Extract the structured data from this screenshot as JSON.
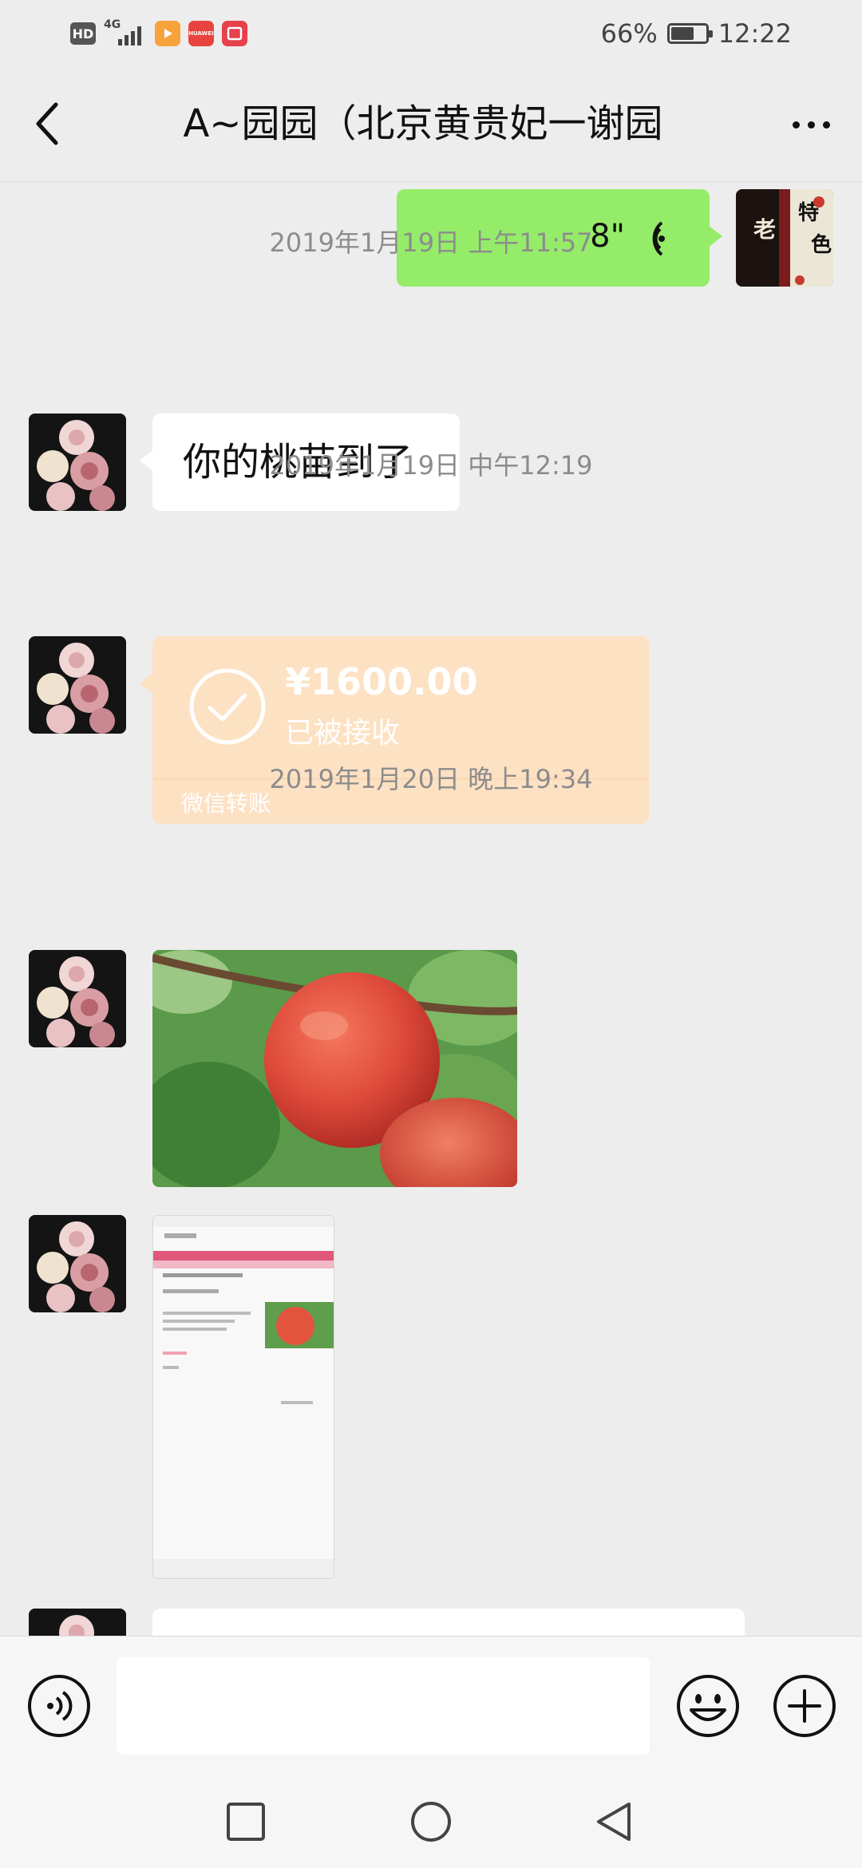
{
  "status_bar": {
    "hd": "HD",
    "network": "4G",
    "huawei_app": "HUAWEI",
    "battery": "66%",
    "battery_level": 0.66,
    "time": "12:22"
  },
  "header": {
    "back_icon": "chevron-left-icon",
    "title": "A~园园（北京黄贵妃一谢园",
    "more_icon": "more-horizontal-icon"
  },
  "messages": {
    "voice_out": {
      "duration": "8\"",
      "icon": "voice-wave-icon"
    },
    "time_1": "2019年1月19日 上午11:57",
    "text_1": "你的桃苗到了",
    "time_2": "2019年1月19日 中午12:19",
    "transfer": {
      "amount": "¥1600.00",
      "status": "已被接收",
      "type_label": "微信转账",
      "icon": "check-circle-icon"
    },
    "time_3": "2019年1月20日 晚上19:34",
    "avatar_me_text": {
      "line1": "特",
      "line2": "色",
      "line3": "老"
    }
  },
  "input_bar": {
    "voice_icon": "voice-mode-icon",
    "text_value": "",
    "emoji_icon": "emoji-icon",
    "plus_icon": "plus-circle-icon"
  },
  "nav_bar": {
    "recents_icon": "square-icon",
    "home_icon": "circle-icon",
    "back_icon": "triangle-back-icon"
  },
  "colors": {
    "background": "#ededed",
    "outgoing_bubble": "#95ec69",
    "incoming_bubble": "#ffffff",
    "transfer_bubble": "#fde1c3",
    "timestamp": "#8c8c8c"
  }
}
